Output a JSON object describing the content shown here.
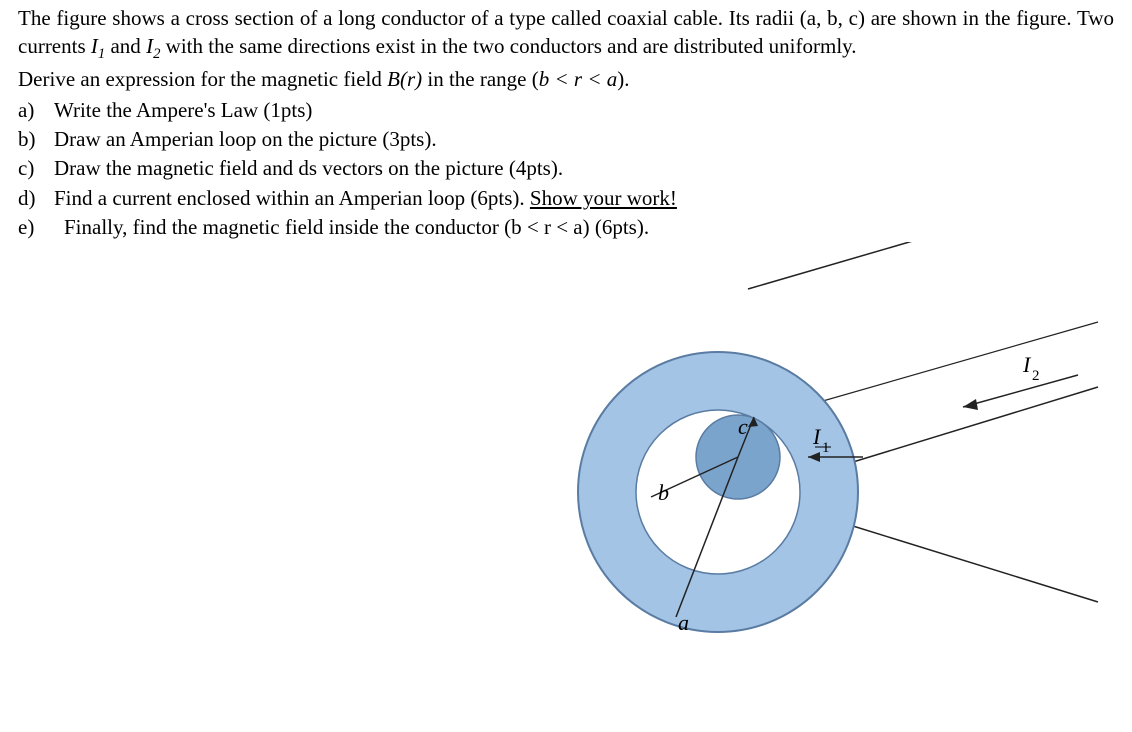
{
  "problem": {
    "intro_part1": "The figure shows a cross section of a long conductor of a type called coaxial cable.  Its radii (a, b, c) are shown in the figure.  Two currents ",
    "i1": "I",
    "i1_sub": "1",
    "intro_mid": " and ",
    "i2": "I",
    "i2_sub": "2",
    "intro_part2": " with the same directions exist in the two conductors and are distributed uniformly.",
    "derive": "Derive an expression for the magnetic field ",
    "br": "B(r)",
    "range_label": " in the range (",
    "range_ineq": "b < r < a",
    "range_close": ")."
  },
  "questions": {
    "a": {
      "letter": "a)",
      "text": "Write the Ampere's Law (1pts)"
    },
    "b": {
      "letter": "b)",
      "text": "Draw an Amperian loop on the picture (3pts)."
    },
    "c": {
      "letter": "c)",
      "text": "Draw the magnetic field and ds vectors on the picture (4pts)."
    },
    "d": {
      "letter": "d)",
      "text_before": "Find a current enclosed within an Amperian loop (6pts).  ",
      "underlined": "Show your work!"
    },
    "e": {
      "letter": "e)",
      "text": " Finally, find the magnetic field inside the conductor (b < r < a) (6pts)."
    }
  },
  "figure": {
    "label_a": "a",
    "label_b": "b",
    "label_c": "c",
    "label_i1": "I",
    "label_i1_sub": "1",
    "label_i2": "I",
    "label_i2_sub": "2"
  },
  "colors": {
    "outer_ring": "#a3c4e5",
    "inner_circle": "#7ba4cd",
    "stroke": "#5a7ca3"
  }
}
